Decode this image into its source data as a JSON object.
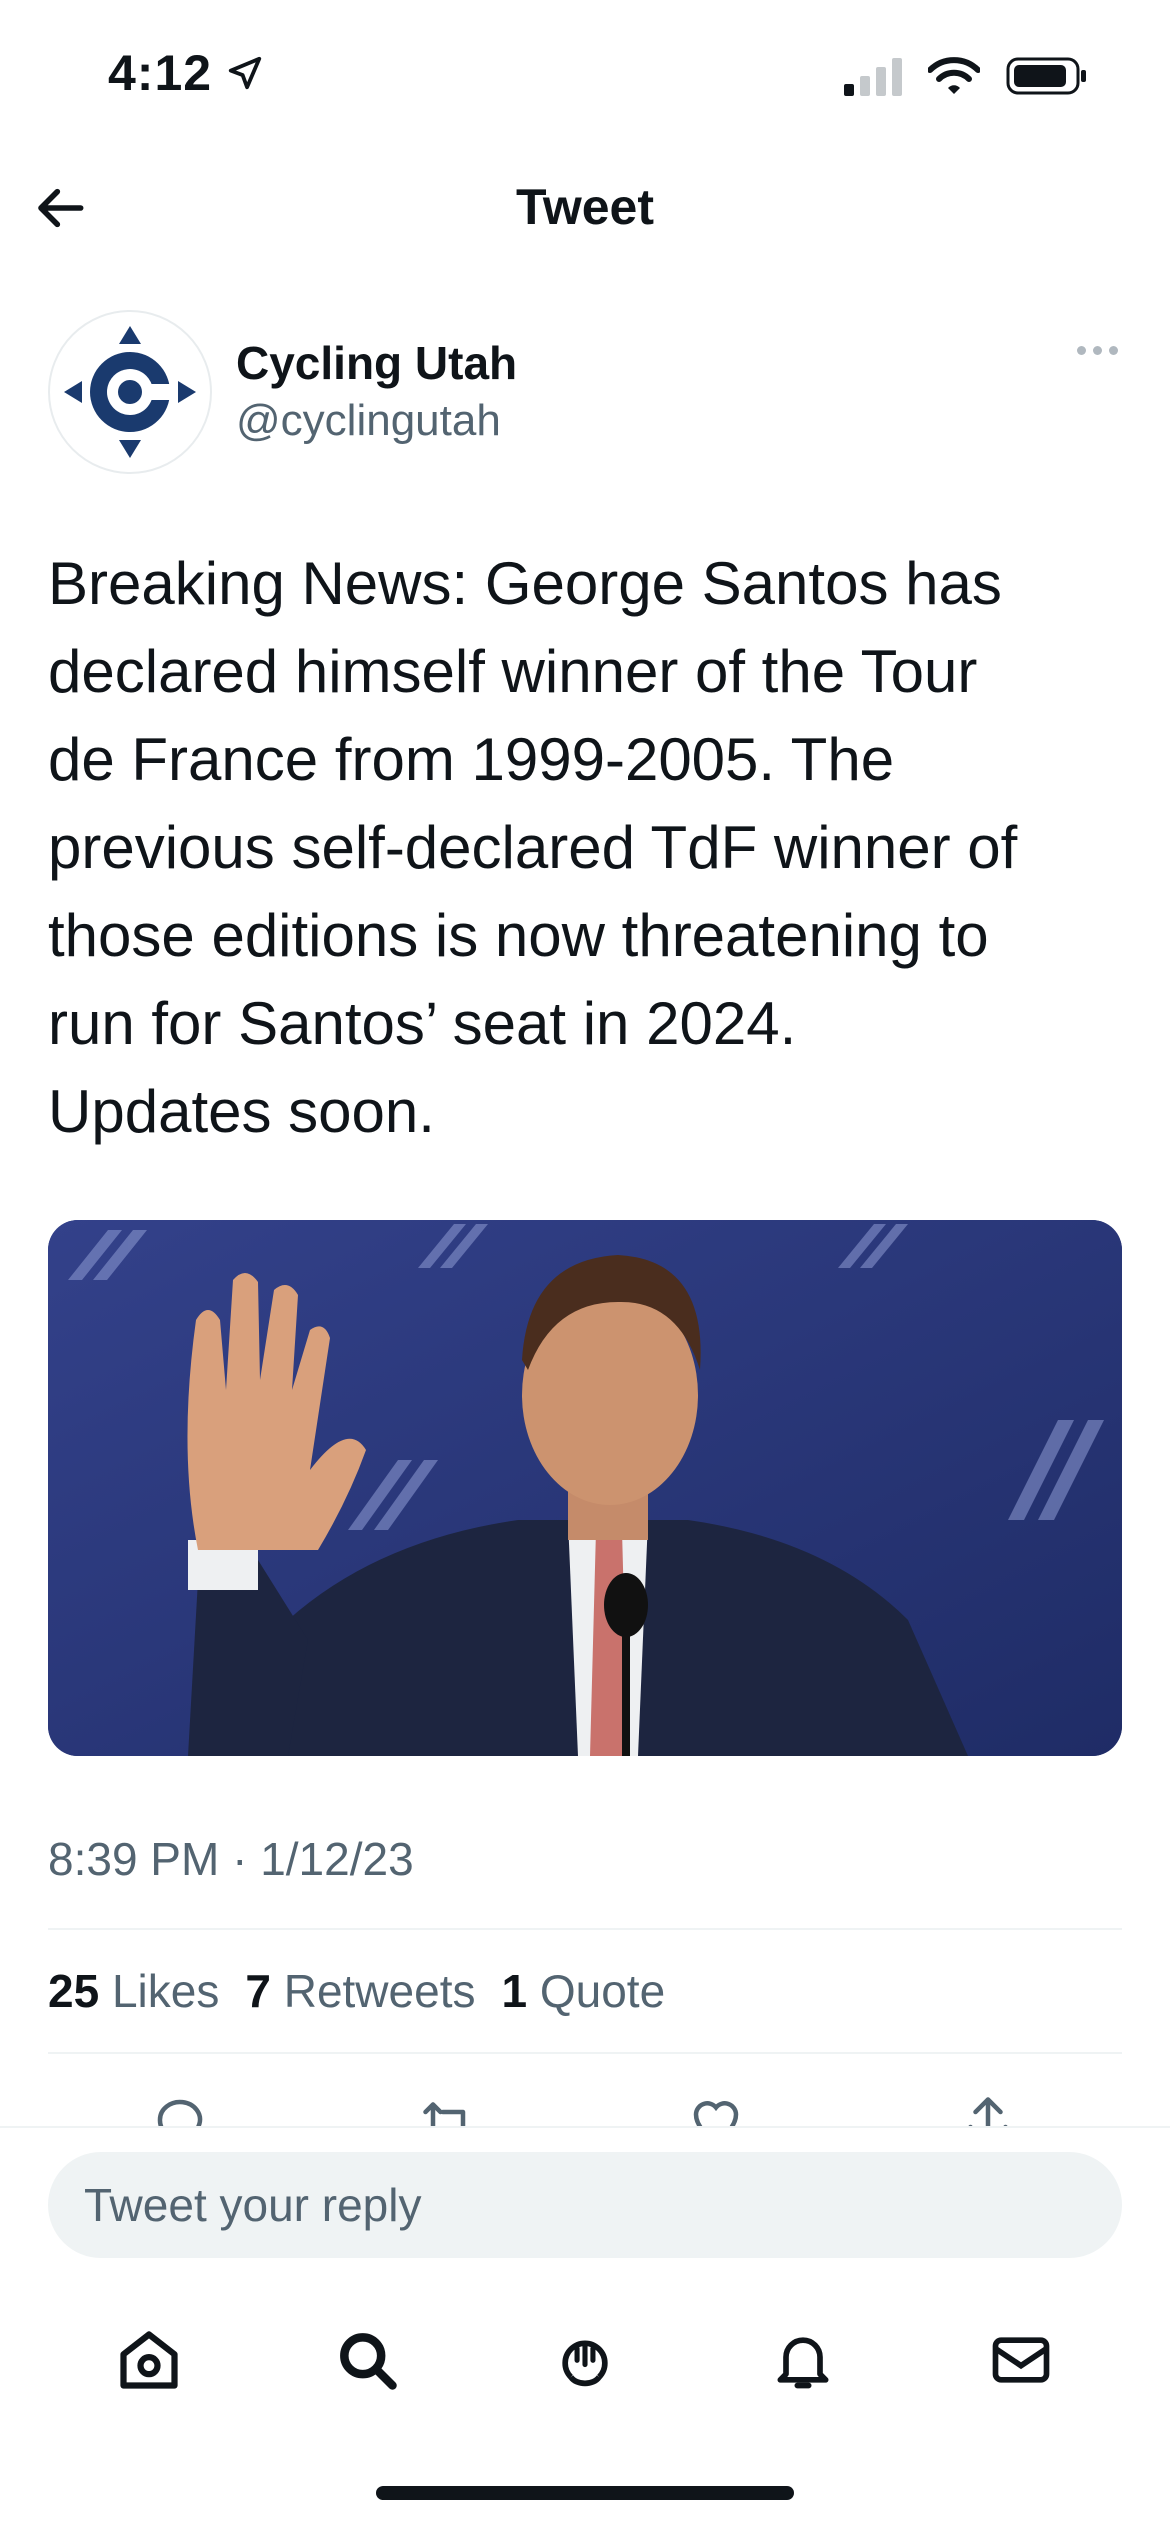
{
  "status_bar": {
    "time": "4:12"
  },
  "header": {
    "title": "Tweet"
  },
  "author": {
    "name": "Cycling Utah",
    "handle": "@cyclingutah"
  },
  "tweet": {
    "text": "Breaking News: George Santos has\ndeclared himself winner of the Tour\nde France from 1999-2005. The\nprevious self-declared TdF winner of\nthose editions is now threatening to\nrun for Santos’ seat in 2024.\nUpdates soon.",
    "timestamp": "8:39 PM · 1/12/23"
  },
  "stats": {
    "likes_count": "25",
    "likes_label": "Likes",
    "retweets_count": "7",
    "retweets_label": "Retweets",
    "quotes_count": "1",
    "quotes_label": "Quote"
  },
  "reply": {
    "placeholder": "Tweet your reply"
  },
  "colors": {
    "text": "#0f1419",
    "secondary": "#536471",
    "avatar_blue": "#1a3a6e",
    "photo_bg": "#2c3a78"
  },
  "icons": [
    "location-arrow-icon",
    "signal-icon",
    "wifi-icon",
    "battery-icon",
    "back-arrow-icon",
    "more-icon",
    "reply-icon",
    "retweet-icon",
    "like-icon",
    "share-icon",
    "home-icon",
    "search-icon",
    "spaces-icon",
    "notifications-icon",
    "messages-icon"
  ]
}
